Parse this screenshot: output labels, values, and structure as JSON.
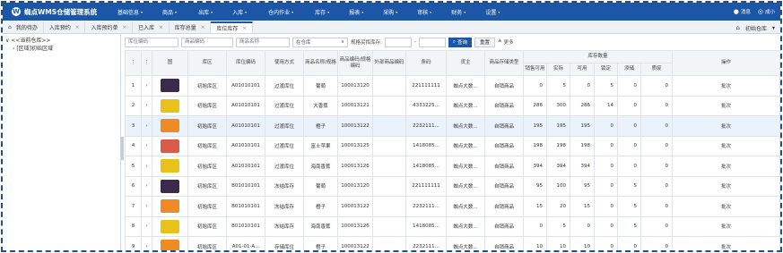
{
  "app": {
    "logo_char": "W",
    "title": "蜘点WMS仓储管理系统"
  },
  "nav": [
    {
      "label": "基础信息",
      "caret": "▾"
    },
    {
      "label": "商品",
      "caret": "▾"
    },
    {
      "label": "出库",
      "caret": "▾"
    },
    {
      "label": "入库",
      "caret": "▾"
    },
    {
      "label": "仓内作业",
      "caret": "▾"
    },
    {
      "label": "库存",
      "caret": "▾"
    },
    {
      "label": "报表",
      "caret": "▾"
    },
    {
      "label": "采购",
      "caret": "▾"
    },
    {
      "label": "审核",
      "caret": "▾"
    },
    {
      "label": "财务",
      "caret": "▾"
    },
    {
      "label": "设置",
      "caret": "▾"
    }
  ],
  "top_right": {
    "message": "消息",
    "user": "成小"
  },
  "tabs": [
    {
      "label": "我的待办",
      "closable": false,
      "active": false
    },
    {
      "label": "入库预约",
      "closable": true,
      "active": false
    },
    {
      "label": "入库预约单",
      "closable": true,
      "active": false
    },
    {
      "label": "已入库",
      "closable": true,
      "active": false
    },
    {
      "label": "库存总量",
      "closable": true,
      "active": false
    },
    {
      "label": "库位库存",
      "closable": true,
      "active": true
    }
  ],
  "tab_close_glyph": "×",
  "warehouse_selector": {
    "label": "初始仓库",
    "caret": "▾"
  },
  "tree": {
    "root": "<<当前仓库>>",
    "root_toggle": "∨",
    "child": "[区域]初始区域",
    "child_toggle": "›"
  },
  "filters": {
    "location_code_placeholder": "库位编码",
    "product_code_placeholder": "商品编码",
    "product_name_placeholder": "商品名称",
    "status_select": "在仓库",
    "status_caret": "∨",
    "spec_range_label": "规格买挥库存:",
    "range_dash": "-",
    "query_label": "查询",
    "reset_label": "重置",
    "more_label": "更多"
  },
  "columns": {
    "icon": "图",
    "area": "库区",
    "location": "库位编码",
    "usage": "使用方式",
    "name": "商品名称/规格",
    "code": "商品编码/规格编码",
    "ext": "外部商品编码",
    "barcode": "条码",
    "owner": "货主",
    "storage": "商品存储类型",
    "qty_group": "库存数量",
    "sale": "销售可用",
    "actual": "实际",
    "avail": "可用",
    "locked": "锁定",
    "adding": "添储",
    "damaged": "质废",
    "op": "操作"
  },
  "row_colors": [
    "#3b2a4a",
    "#e8c21a",
    "#f08a24",
    "#d85a4a",
    "#e8c21a",
    "#3b2a4a",
    "#f08a24",
    "#e8c21a",
    "#f08a24"
  ],
  "rows": [
    {
      "no": "1",
      "area": "初始库区",
      "location": "A01010101",
      "usage": "过渡库位",
      "name": "葡萄",
      "code": "100013120",
      "ext": "",
      "barcode": "221111111",
      "owner": "蜘点大数...",
      "storage": "自销商品",
      "sale": "0",
      "actual": "5",
      "avail": "0",
      "locked": "5",
      "adding": "0",
      "damaged": "0",
      "op": "批次"
    },
    {
      "no": "2",
      "area": "初始库区",
      "location": "A01010101",
      "usage": "过渡库位",
      "name": "大香蕉",
      "code": "100013121",
      "ext": "",
      "barcode": "4333225...",
      "owner": "蜘点大数...",
      "storage": "自销商品",
      "sale": "286",
      "actual": "300",
      "avail": "286",
      "locked": "14",
      "adding": "0",
      "damaged": "0",
      "op": "批次"
    },
    {
      "no": "3",
      "area": "初始库区",
      "location": "A01010101",
      "usage": "过渡库位",
      "name": "橙子",
      "code": "100013122",
      "ext": "",
      "barcode": "2232111...",
      "owner": "蜘点大数...",
      "storage": "自销商品",
      "sale": "195",
      "actual": "195",
      "avail": "195",
      "locked": "0",
      "adding": "0",
      "damaged": "0",
      "op": "批次"
    },
    {
      "no": "4",
      "area": "初始库区",
      "location": "A01010101",
      "usage": "过渡库位",
      "name": "富士苹果",
      "code": "100013125",
      "ext": "",
      "barcode": "1418085...",
      "owner": "蜘点大数...",
      "storage": "自销商品",
      "sale": "198",
      "actual": "198",
      "avail": "198",
      "locked": "0",
      "adding": "0",
      "damaged": "0",
      "op": "批次"
    },
    {
      "no": "5",
      "area": "初始库区",
      "location": "A01010101",
      "usage": "过渡库位",
      "name": "海南香蕉",
      "code": "100013126",
      "ext": "",
      "barcode": "1418085...",
      "owner": "蜘点大数...",
      "storage": "自销商品",
      "sale": "394",
      "actual": "394",
      "avail": "394",
      "locked": "0",
      "adding": "0",
      "damaged": "0",
      "op": "批次"
    },
    {
      "no": "6",
      "area": "初始库区",
      "location": "B01010101",
      "usage": "冻结库存",
      "name": "葡萄",
      "code": "100013120",
      "ext": "",
      "barcode": "221111111",
      "owner": "蜘点大数...",
      "storage": "自销商品",
      "sale": "95",
      "actual": "100",
      "avail": "95",
      "locked": "0",
      "adding": "5",
      "damaged": "0",
      "op": "批次"
    },
    {
      "no": "7",
      "area": "初始库区",
      "location": "B01010101",
      "usage": "冻结库存",
      "name": "橙子",
      "code": "100013122",
      "ext": "",
      "barcode": "2232111...",
      "owner": "蜘点大数...",
      "storage": "自销商品",
      "sale": "15",
      "actual": "20",
      "avail": "15",
      "locked": "0",
      "adding": "5",
      "damaged": "0",
      "op": "批次"
    },
    {
      "no": "8",
      "area": "初始库区",
      "location": "B01010101",
      "usage": "冻结库存",
      "name": "海南香蕉",
      "code": "100013126",
      "ext": "",
      "barcode": "1418085...",
      "owner": "蜘点大数...",
      "storage": "自销商品",
      "sale": "0",
      "actual": "5",
      "avail": "0",
      "locked": "0",
      "adding": "5",
      "damaged": "0",
      "op": "批次"
    },
    {
      "no": "9",
      "area": "初始库区",
      "location": "A01-01-A...",
      "usage": "存储库位",
      "name": "橙子",
      "code": "100013122",
      "ext": "",
      "barcode": "2232111...",
      "owner": "蜘点大数...",
      "storage": "自销商品",
      "sale": "10",
      "actual": "10",
      "avail": "10",
      "locked": "0",
      "adding": "0",
      "damaged": "0",
      "op": "批次"
    }
  ]
}
